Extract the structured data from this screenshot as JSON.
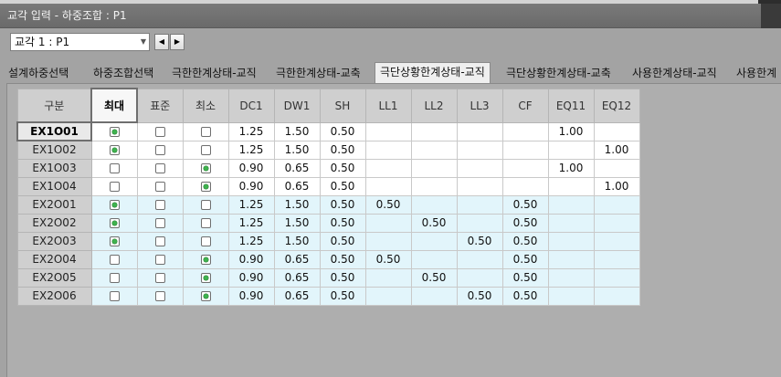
{
  "window": {
    "title": "교각 입력 - 하중조합 : P1"
  },
  "toolbar": {
    "combo_value": "교각 1 : P1",
    "prev_label": "◀",
    "next_label": "▶"
  },
  "tabs": [
    {
      "label": "설계하중선택",
      "active": false
    },
    {
      "label": "하중조합선택",
      "active": false
    },
    {
      "label": "극한한계상태-교직",
      "active": false
    },
    {
      "label": "극한한계상태-교축",
      "active": false
    },
    {
      "label": "극단상황한계상태-교직",
      "active": true
    },
    {
      "label": "극단상황한계상태-교축",
      "active": false
    },
    {
      "label": "사용한계상태-교직",
      "active": false
    },
    {
      "label": "사용한계",
      "active": false
    }
  ],
  "grid": {
    "headers": [
      "구분",
      "최대",
      "표준",
      "최소",
      "DC1",
      "DW1",
      "SH",
      "LL1",
      "LL2",
      "LL3",
      "CF",
      "EQ11",
      "EQ12"
    ],
    "selected_option_index": 0,
    "rows": [
      {
        "name": "EX1O01",
        "option": 0,
        "values": [
          "1.25",
          "1.50",
          "0.50",
          "",
          "",
          "",
          "",
          "1.00",
          ""
        ]
      },
      {
        "name": "EX1O02",
        "option": 0,
        "values": [
          "1.25",
          "1.50",
          "0.50",
          "",
          "",
          "",
          "",
          "",
          "1.00"
        ]
      },
      {
        "name": "EX1O03",
        "option": 2,
        "values": [
          "0.90",
          "0.65",
          "0.50",
          "",
          "",
          "",
          "",
          "1.00",
          ""
        ]
      },
      {
        "name": "EX1O04",
        "option": 2,
        "values": [
          "0.90",
          "0.65",
          "0.50",
          "",
          "",
          "",
          "",
          "",
          "1.00"
        ]
      },
      {
        "name": "EX2O01",
        "option": 0,
        "values": [
          "1.25",
          "1.50",
          "0.50",
          "0.50",
          "",
          "",
          "0.50",
          "",
          ""
        ]
      },
      {
        "name": "EX2O02",
        "option": 0,
        "values": [
          "1.25",
          "1.50",
          "0.50",
          "",
          "0.50",
          "",
          "0.50",
          "",
          ""
        ]
      },
      {
        "name": "EX2O03",
        "option": 0,
        "values": [
          "1.25",
          "1.50",
          "0.50",
          "",
          "",
          "0.50",
          "0.50",
          "",
          ""
        ]
      },
      {
        "name": "EX2O04",
        "option": 2,
        "values": [
          "0.90",
          "0.65",
          "0.50",
          "0.50",
          "",
          "",
          "0.50",
          "",
          ""
        ]
      },
      {
        "name": "EX2O05",
        "option": 2,
        "values": [
          "0.90",
          "0.65",
          "0.50",
          "",
          "0.50",
          "",
          "0.50",
          "",
          ""
        ]
      },
      {
        "name": "EX2O06",
        "option": 2,
        "values": [
          "0.90",
          "0.65",
          "0.50",
          "",
          "",
          "0.50",
          "0.50",
          "",
          ""
        ]
      }
    ]
  },
  "colors": {
    "group1_bg": "#ffffff",
    "group2_bg": "#e2f5fb",
    "radio_on": "#3fb24f",
    "header_bg": "#cfcfcf"
  }
}
